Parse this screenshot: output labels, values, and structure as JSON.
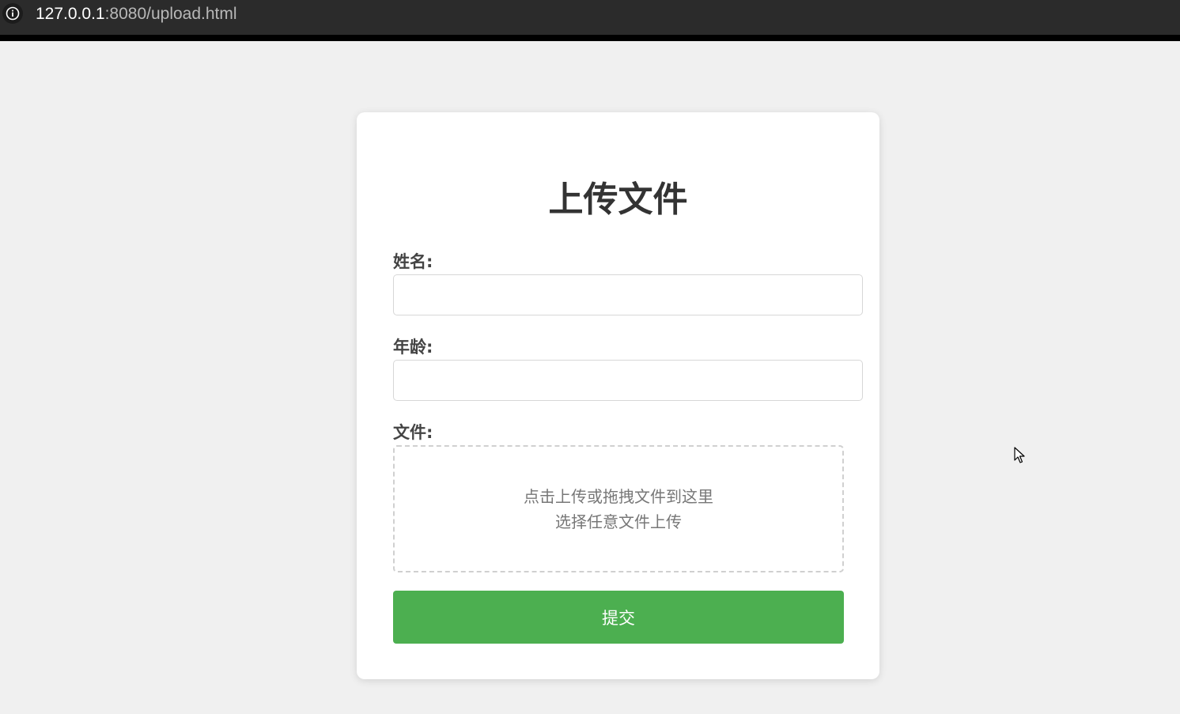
{
  "browser": {
    "url_host": "127.0.0.1",
    "url_rest": ":8080/upload.html",
    "info_icon": "info-icon"
  },
  "form": {
    "title": "上传文件",
    "name_label": "姓名:",
    "name_value": "",
    "age_label": "年龄:",
    "age_value": "",
    "file_label": "文件:",
    "dropzone_line1": "点击上传或拖拽文件到这里",
    "dropzone_line2": "选择任意文件上传",
    "submit_label": "提交"
  },
  "colors": {
    "background": "#f0f0f0",
    "card": "#ffffff",
    "submit_button": "#4caf50",
    "title_text": "#333333",
    "label_text": "#444444",
    "dropzone_text": "#777777"
  }
}
